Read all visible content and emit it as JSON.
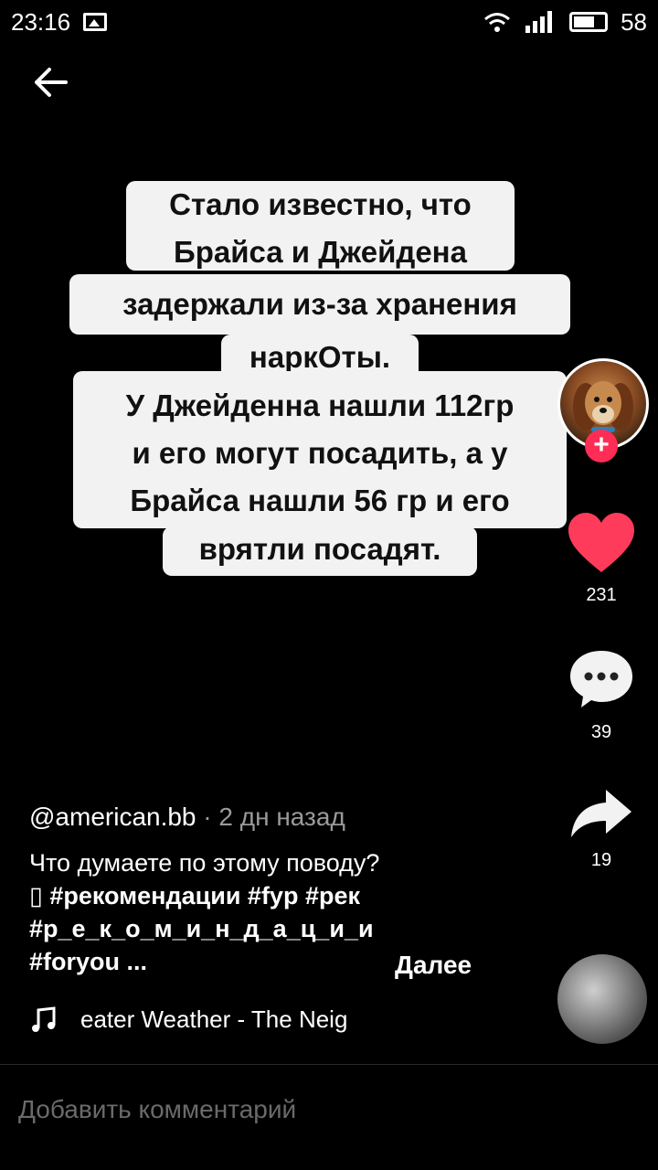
{
  "status_bar": {
    "time": "23:16",
    "battery": "58"
  },
  "video": {
    "overlay_lines": [
      "Стало известно, что",
      "Брайса и Джейдена",
      "задержали из-за хранения",
      "наркОты.",
      "У Джейденна нашли 112гр",
      "и его могут посадить, а у",
      "Брайса нашли 56 гр и его",
      "врятли посадят."
    ]
  },
  "actions": {
    "likes": "231",
    "comments": "39",
    "shares": "19"
  },
  "post": {
    "username": "@american.bb",
    "time_ago": "· 2 дн назад",
    "caption": "Что думаете по этому поводу?",
    "tags_line1": "▯ #рекомендации #fyp #рек",
    "tags_line2": "#р_е_к_о_м_и_н_д_а_ц_и_и",
    "tags_line3": "#foryou ...",
    "more_label": "Далее",
    "music": "eater Weather - The Neig"
  },
  "comment": {
    "placeholder": "Добавить комментарий"
  },
  "colors": {
    "like": "#ff3b5c",
    "follow": "#ff2d55",
    "background": "#000000"
  }
}
